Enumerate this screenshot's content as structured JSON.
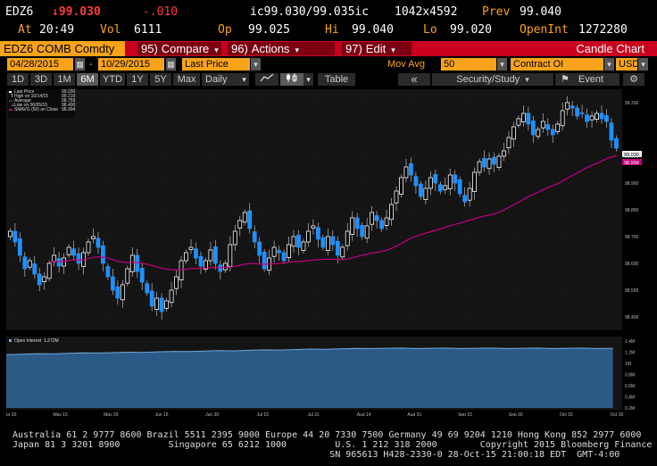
{
  "quote": {
    "row1": {
      "ticker": "EDZ6",
      "last": "↓99.030",
      "change": "-.010",
      "bid_ask": "ic99.030/99.035ic",
      "size": "1042x4592",
      "prev_label": "Prev",
      "prev_value": "99.040"
    },
    "row2": {
      "at_label": "At",
      "at_value": "20:49",
      "vol_label": "Vol",
      "vol_value": "6111",
      "op_label": "Op",
      "op_value": "99.025",
      "hi_label": "Hi",
      "hi_value": "99.040",
      "lo_label": "Lo",
      "lo_value": "99.020",
      "oi_label": "OpenInt",
      "oi_value": "1272280"
    }
  },
  "menubar": {
    "security": "EDZ6 COMB Comdty",
    "compare_num": "95)",
    "compare": "Compare",
    "actions_num": "96)",
    "actions": "Actions",
    "edit_num": "97)",
    "edit": "Edit",
    "title": "Candle Chart"
  },
  "params": {
    "start_date": "04/28/2015",
    "end_date": "10/29/2015",
    "price_type": "Last Price",
    "study": "Mov Avg",
    "study_period": "50",
    "lower_study": "Contract OI",
    "currency": "USD"
  },
  "toolbar": {
    "ranges": [
      "1D",
      "3D",
      "1M",
      "6M",
      "YTD",
      "1Y",
      "5Y",
      "Max"
    ],
    "active_range": "6M",
    "frequency": "Daily",
    "table": "Table",
    "security_study": "Security/Study",
    "event": "Event"
  },
  "legend": {
    "last_price": "Last Price",
    "last_price_value": "99.030",
    "high_label": "High on 10/14/15",
    "high_value": "99.210",
    "average_label": "Average",
    "average_value": "98.759",
    "low_label": "Low on 06/05/15",
    "low_value": "98.400",
    "smavg_label": "SMAVG (50) on Close",
    "smavg_value": "98.994",
    "oi_label": "Open Interest",
    "oi_value": "1.272M"
  },
  "colors": {
    "up": "#ffffff",
    "down": "#1e90ff",
    "mavg": "#c4007c",
    "amber": "#f9a31a",
    "red_bar": "#c8001e"
  },
  "chart_data": {
    "type": "candlestick",
    "y_ticks": [
      "99.200",
      "99.000",
      "98.900",
      "98.800",
      "98.700",
      "98.600",
      "98.500",
      "98.400"
    ],
    "ylim": [
      98.35,
      99.25
    ],
    "oi_ticks": [
      "1.4M",
      "1.2M",
      "1M",
      "0.8M",
      "0.6M",
      "0.4M",
      "0.2M"
    ],
    "x_ticks": [
      "Apr 30",
      "May 15",
      "May 29",
      "Jun 15",
      "Jun 30",
      "Jul 15",
      "Jul 31",
      "Aug 14",
      "Aug 31",
      "Sep 15",
      "Sep 30",
      "Oct 15",
      "Oct 30"
    ],
    "x_year": "2015",
    "last_tag": "99.030",
    "mavg_tag": "98.994",
    "closes": [
      98.72,
      98.68,
      98.63,
      98.58,
      98.61,
      98.56,
      98.52,
      98.55,
      98.6,
      98.63,
      98.59,
      98.62,
      98.66,
      98.63,
      98.6,
      98.64,
      98.68,
      98.7,
      98.66,
      98.6,
      98.55,
      98.5,
      98.47,
      98.52,
      98.58,
      98.63,
      98.57,
      98.53,
      98.49,
      98.44,
      98.47,
      98.42,
      98.46,
      98.5,
      98.55,
      98.61,
      98.64,
      98.66,
      98.62,
      98.59,
      98.61,
      98.65,
      98.6,
      98.57,
      98.6,
      98.67,
      98.72,
      98.76,
      98.79,
      98.73,
      98.68,
      98.63,
      98.58,
      98.62,
      98.66,
      98.64,
      98.61,
      98.67,
      98.7,
      98.66,
      98.68,
      98.72,
      98.74,
      98.69,
      98.66,
      98.7,
      98.67,
      98.63,
      98.66,
      98.72,
      98.77,
      98.73,
      98.7,
      98.74,
      98.79,
      98.76,
      98.73,
      98.77,
      98.82,
      98.87,
      98.92,
      98.96,
      98.93,
      98.89,
      98.85,
      98.88,
      98.92,
      98.9,
      98.87,
      98.89,
      98.93,
      98.9,
      98.86,
      98.83,
      98.88,
      98.94,
      98.98,
      98.96,
      98.99,
      98.97,
      99.0,
      99.02,
      99.07,
      99.11,
      99.14,
      99.16,
      99.12,
      99.08,
      99.1,
      99.13,
      99.1,
      99.08,
      99.12,
      99.17,
      99.2,
      99.18,
      99.15,
      99.16,
      99.13,
      99.15,
      99.16,
      99.14,
      99.13,
      99.06,
      99.03
    ]
  }
}
